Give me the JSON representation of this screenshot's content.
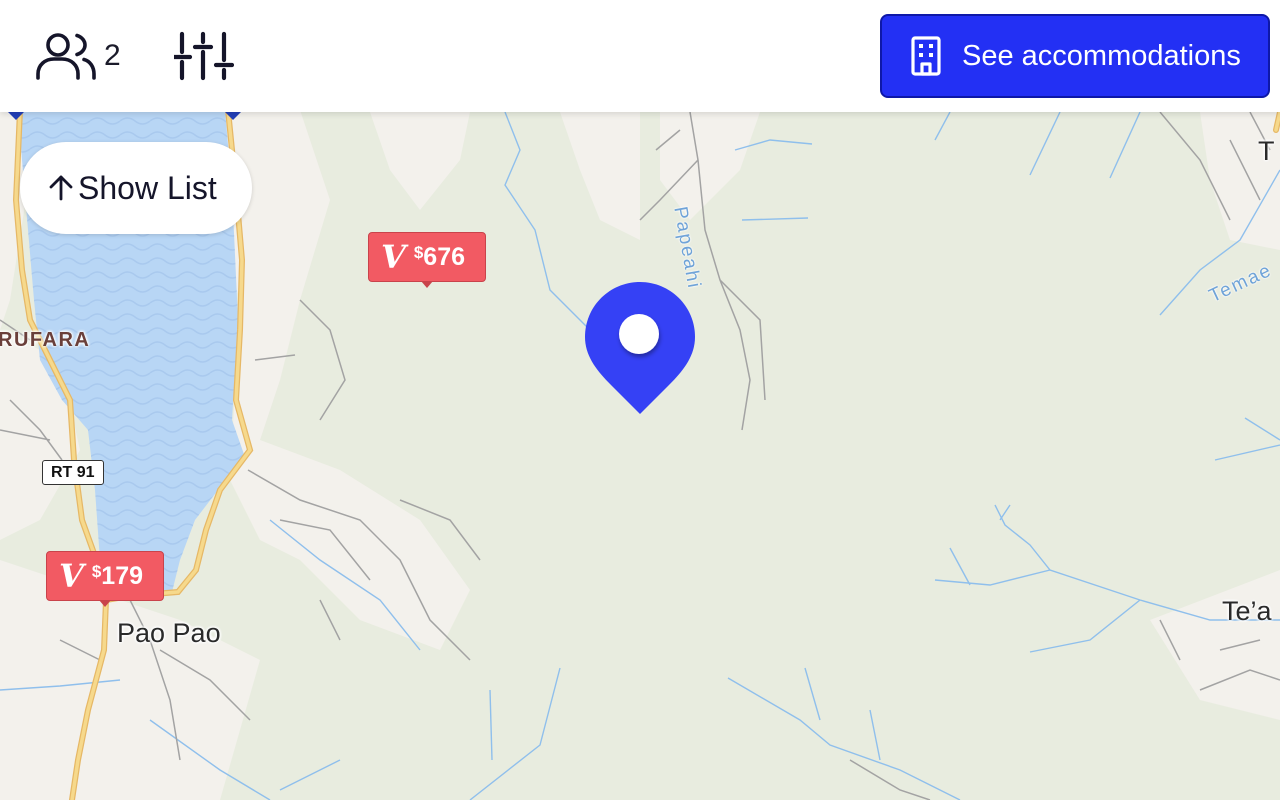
{
  "header": {
    "guests": {
      "icon": "users-icon",
      "count": "2"
    },
    "filters": {
      "icon": "sliders-icon"
    },
    "see_accommodations": {
      "icon": "building-icon",
      "label": "See accommodations"
    }
  },
  "show_list": {
    "icon": "arrow-up-icon",
    "label": "Show List"
  },
  "map": {
    "places": {
      "pao_pao": "Pao Pao",
      "urufara": "RUFARA",
      "teavaro": "Te’a",
      "top_right": "T"
    },
    "streams": {
      "papeahi": "Papeahi",
      "temae": "Temae"
    },
    "road_shield": "RT 91",
    "markers": [
      {
        "currency": "$",
        "amount": "676",
        "icon": "v-logo-icon"
      },
      {
        "currency": "$",
        "amount": "179",
        "icon": "v-logo-icon"
      }
    ],
    "pin": {
      "icon": "location-pin-icon"
    }
  },
  "colors": {
    "land": "#e8ecdf",
    "water": "#b8d6f5",
    "road_major": "#f6d98c",
    "road_minor": "#9a9a9a",
    "stream": "#8fbfec",
    "developed": "#f3f1ec",
    "accent": "#2330f4",
    "marker": "#f25a63",
    "pin": "#3541f5"
  }
}
